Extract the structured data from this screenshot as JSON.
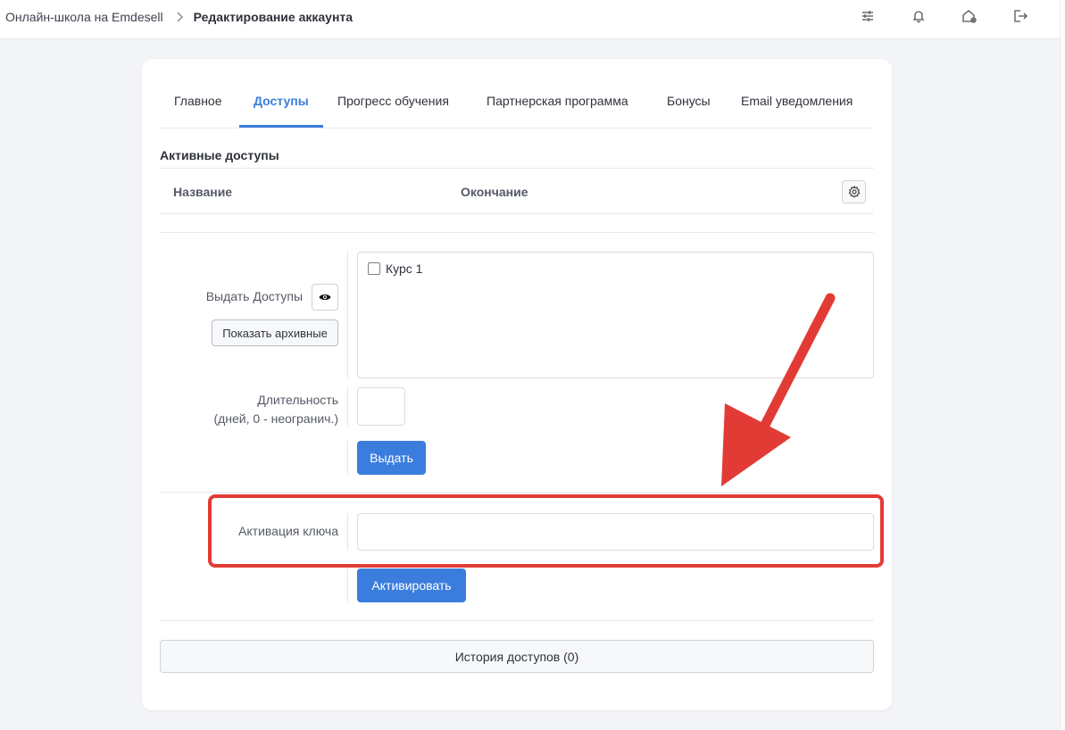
{
  "breadcrumb": {
    "parent": "Онлайн-школа на Emdesell",
    "current": "Редактирование аккаунта"
  },
  "top_icons": [
    "sliders-icon",
    "bell-icon",
    "home-gear-icon",
    "logout-icon"
  ],
  "tabs": [
    {
      "label": "Главное",
      "active": false
    },
    {
      "label": "Доступы",
      "active": true
    },
    {
      "label": "Прогресс обучения",
      "active": false
    },
    {
      "label": "Партнерская программа",
      "active": false
    },
    {
      "label": "Бонусы",
      "active": false
    },
    {
      "label": "Email уведомления",
      "active": false
    }
  ],
  "active_access": {
    "title": "Активные доступы",
    "columns": [
      "Название",
      "Окончание"
    ]
  },
  "grant": {
    "label": "Выдать Доступы",
    "show_archived": "Показать архивные",
    "courses": [
      {
        "name": "Курс 1",
        "checked": false
      }
    ],
    "duration_label_line1": "Длительность",
    "duration_label_line2": "(дней, 0 - неогранич.)",
    "duration_value": "",
    "submit": "Выдать"
  },
  "key_activation": {
    "label": "Активация ключа",
    "value": "",
    "submit": "Активировать"
  },
  "history_button": "История доступов (0)",
  "colors": {
    "accent": "#3b7ddd",
    "annotation": "#e23b35",
    "background": "#f3f4f7"
  }
}
